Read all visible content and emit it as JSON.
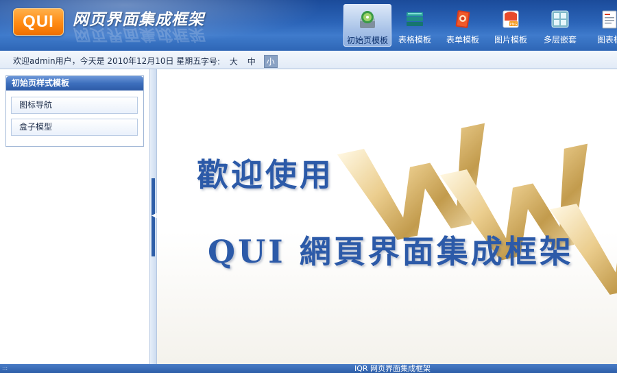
{
  "header": {
    "logo_text": "QUI",
    "title": "网页界面集成框架",
    "nav": [
      {
        "label": "初始页模板",
        "icon": "disc-icon",
        "active": true
      },
      {
        "label": "表格模板",
        "icon": "table-stack-icon",
        "active": false
      },
      {
        "label": "表单模板",
        "icon": "form-icon",
        "active": false
      },
      {
        "label": "图片模板",
        "icon": "png-image-icon",
        "active": false
      },
      {
        "label": "多层嵌套",
        "icon": "grid-layers-icon",
        "active": false
      },
      {
        "label": "图表模",
        "icon": "chart-document-icon",
        "active": false
      }
    ]
  },
  "infobar": {
    "welcome": "欢迎admin用户，今天是 2010年12月10日 星期五",
    "font_size_label": "字号:",
    "font_sizes": [
      "大",
      "中",
      "小"
    ],
    "selected_font_size": "小"
  },
  "sidebar": {
    "panel_title": "初始页样式模板",
    "items": [
      {
        "label": "图标导航"
      },
      {
        "label": "盒子模型"
      }
    ]
  },
  "main": {
    "welcome_line1": "歡迎使用",
    "welcome_line2": "QUI 網頁界面集成框架"
  },
  "footer": {
    "text": "IQR 网页界面集成框架"
  },
  "colors": {
    "header_blue": "#2b64b8",
    "logo_orange": "#ff8a12",
    "welcome_text_blue": "#2c5aa8",
    "gold": "#d9b35a"
  }
}
